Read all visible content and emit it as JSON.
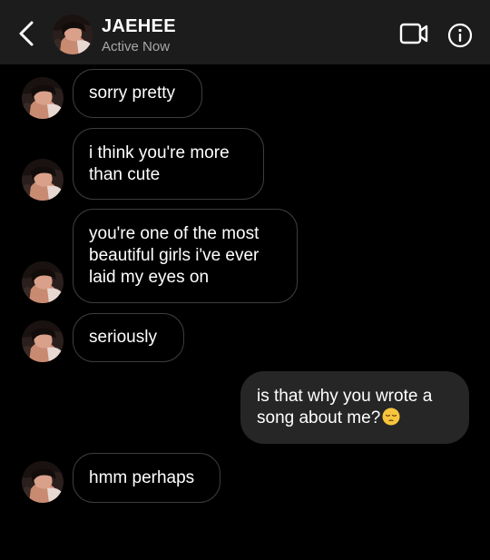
{
  "header": {
    "contact_name": "JAEHEE",
    "status": "Active Now",
    "icons": [
      "back-chevron-icon",
      "video-call-icon",
      "info-icon"
    ]
  },
  "messages": [
    {
      "direction": "incoming",
      "text": "sorry pretty",
      "avatar_shown": true
    },
    {
      "direction": "incoming",
      "text": "i think you're more\nthan cute",
      "avatar_shown": true
    },
    {
      "direction": "incoming",
      "text": "you're one of the most\nbeautiful girls i've ever\nlaid my eyes on",
      "avatar_shown": true
    },
    {
      "direction": "incoming",
      "text": "seriously",
      "avatar_shown": true
    },
    {
      "direction": "outgoing",
      "text": "is that why you wrote a\nsong about me?",
      "emoji": "pensive-face-emoji"
    },
    {
      "direction": "incoming",
      "text": "hmm perhaps",
      "avatar_shown": true
    }
  ],
  "colors": {
    "background": "#000000",
    "header": "#1c1c1c",
    "incoming_border": "#3d3d3d",
    "outgoing_bubble": "#262626",
    "status_text": "#a8a8a8"
  }
}
